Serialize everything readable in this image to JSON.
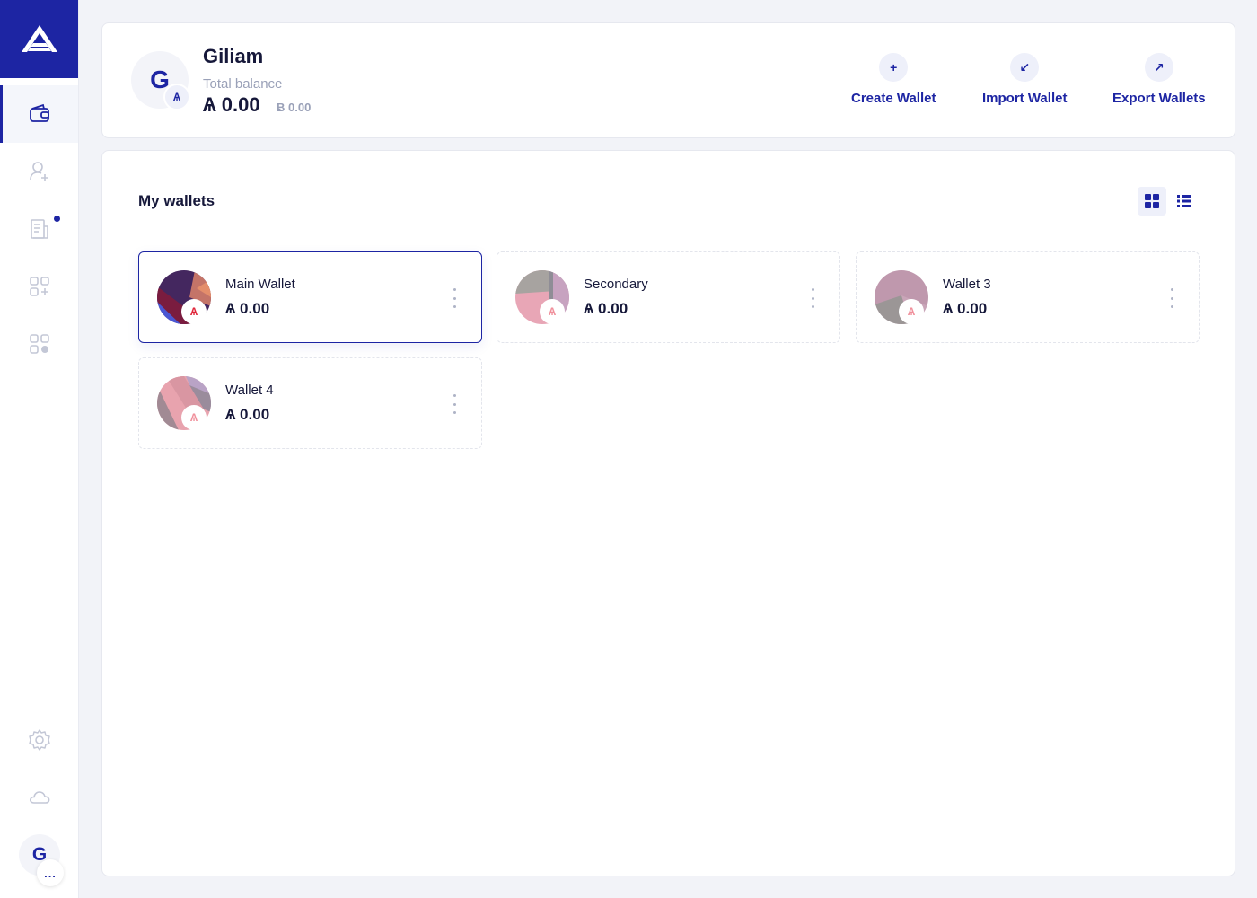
{
  "app": {
    "brand_color": "#1d25a3",
    "logo_icon": "ark-logo-icon"
  },
  "sidebar": {
    "items": [
      {
        "name": "wallets",
        "icon": "wallet-icon",
        "active": true
      },
      {
        "name": "contacts",
        "icon": "add-contact-icon",
        "active": false
      },
      {
        "name": "announcements",
        "icon": "news-icon",
        "active": false,
        "has_notification": true
      },
      {
        "name": "plugins",
        "icon": "add-plugin-icon",
        "active": false
      },
      {
        "name": "plugin-manager",
        "icon": "plugins-icon",
        "active": false
      }
    ],
    "bottom_items": [
      {
        "name": "settings",
        "icon": "gear-icon"
      },
      {
        "name": "network",
        "icon": "cloud-icon"
      }
    ],
    "user_initial": "G",
    "user_more": "..."
  },
  "header": {
    "avatar_initial": "G",
    "currency_badge": "Ѧ",
    "name": "Giliam",
    "total_label": "Total balance",
    "total_value": "Ѧ 0.00",
    "total_alt_value": "Ƀ 0.00",
    "actions": [
      {
        "label": "Create Wallet",
        "icon": "plus-icon",
        "glyph": "+"
      },
      {
        "label": "Import Wallet",
        "icon": "import-icon",
        "glyph": "↙"
      },
      {
        "label": "Export Wallets",
        "icon": "export-icon",
        "glyph": "↗"
      }
    ]
  },
  "main": {
    "title": "My wallets",
    "view_modes": [
      {
        "name": "grid",
        "icon": "grid-view-icon",
        "active": true
      },
      {
        "name": "list",
        "icon": "list-view-icon",
        "active": false
      }
    ],
    "wallets": [
      {
        "name": "Main Wallet",
        "balance": "Ѧ 0.00",
        "selected": true,
        "badge": "Ѧ",
        "badge_color": "#e0263a"
      },
      {
        "name": "Secondary",
        "balance": "Ѧ 0.00",
        "selected": false,
        "badge": "Ѧ",
        "badge_color": "#f08f9b"
      },
      {
        "name": "Wallet 3",
        "balance": "Ѧ 0.00",
        "selected": false,
        "badge": "Ѧ",
        "badge_color": "#f08f9b"
      },
      {
        "name": "Wallet 4",
        "balance": "Ѧ 0.00",
        "selected": false,
        "badge": "Ѧ",
        "badge_color": "#f08f9b"
      }
    ]
  }
}
